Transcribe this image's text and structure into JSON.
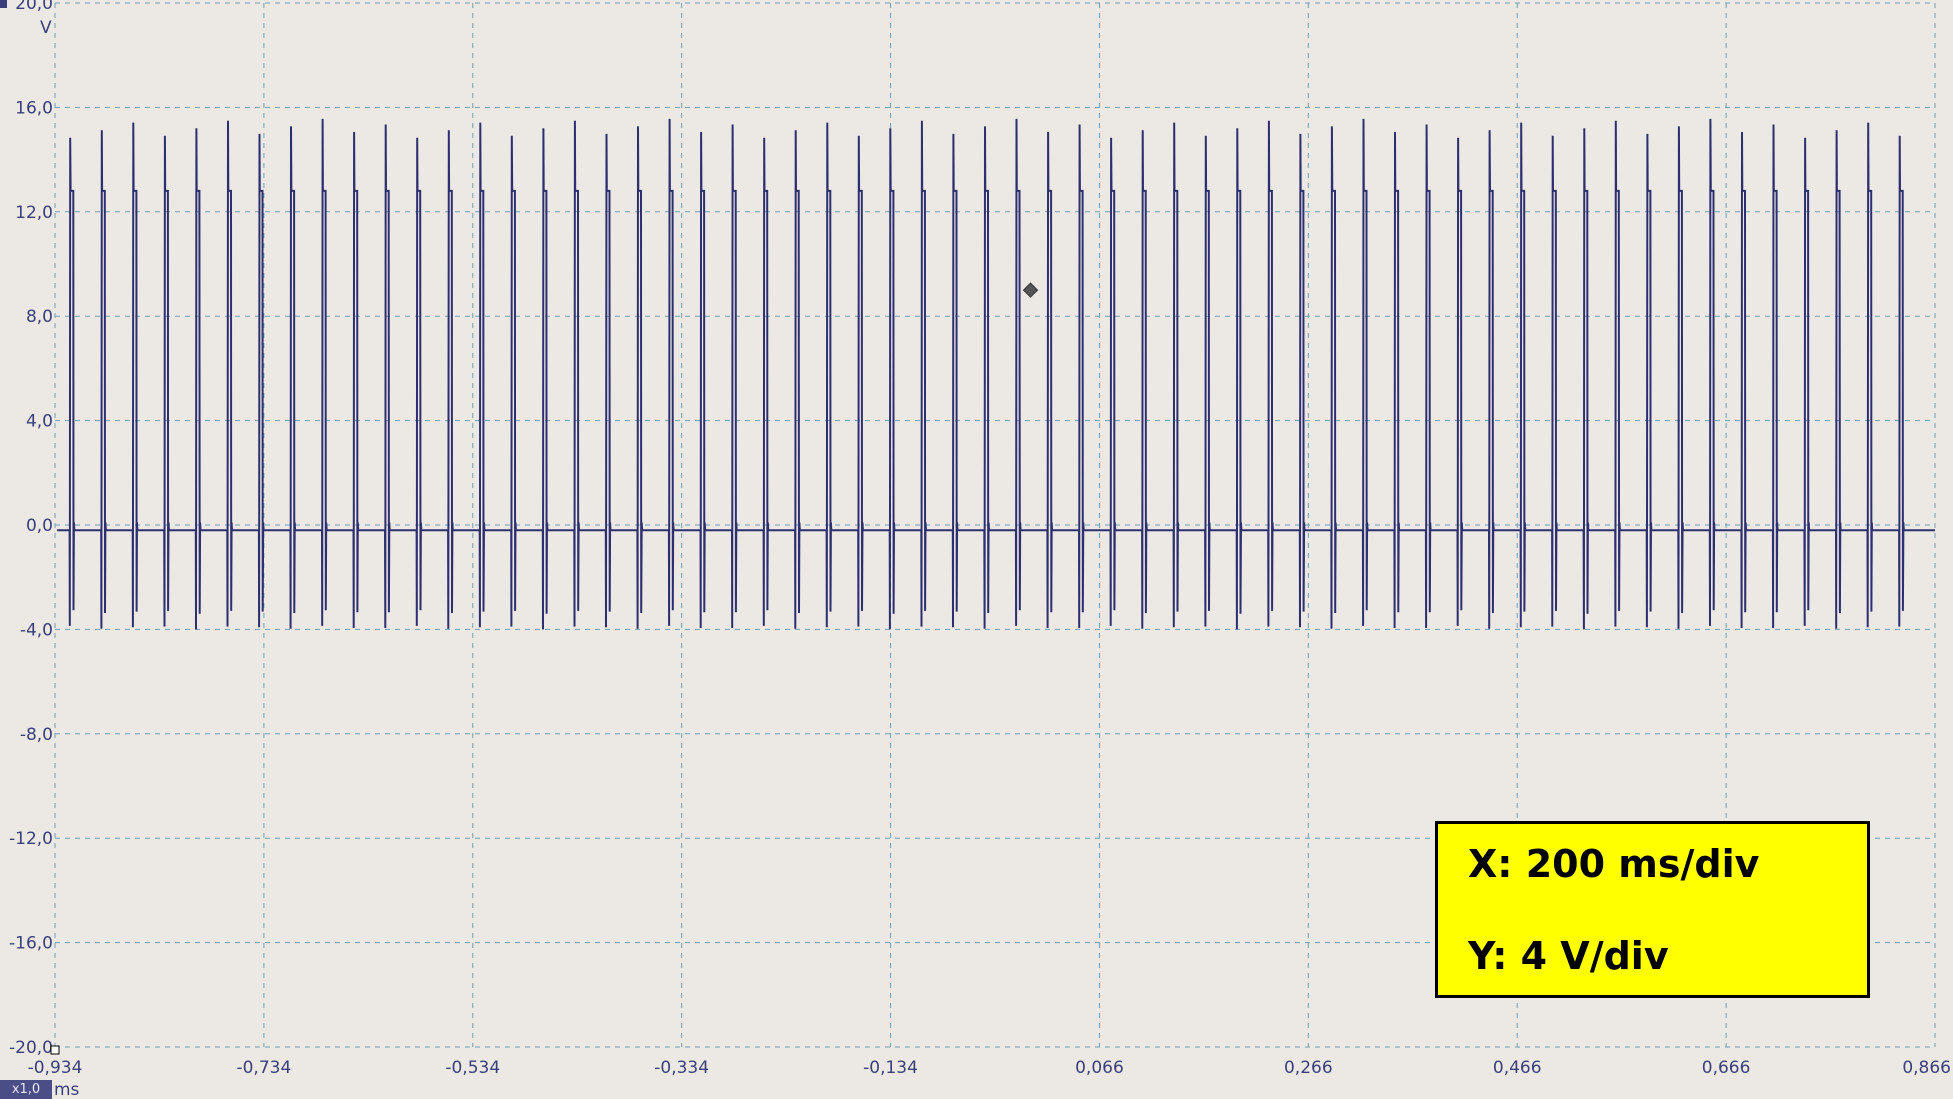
{
  "chart_data": {
    "type": "line",
    "title": "",
    "xlabel": "ms",
    "ylabel": "V",
    "xlim": [
      -0.934,
      0.866
    ],
    "ylim": [
      -20.0,
      20.0
    ],
    "x_ticks": [
      "-0,934",
      "-0,734",
      "-0,534",
      "-0,334",
      "-0,134",
      "0,066",
      "0,266",
      "0,466",
      "0,666",
      "0,866"
    ],
    "y_ticks": [
      "20,0",
      "16,0",
      "12,0",
      "8,0",
      "4,0",
      "0,0",
      "-4,0",
      "-8,0",
      "-12,0",
      "-16,0",
      "-20,0"
    ],
    "grid": true,
    "series": [
      {
        "color": "#2e2f6e",
        "pulse_period": 0.0302,
        "first_rise": -0.92,
        "pulse_width": 0.0035,
        "high": 12.8,
        "low": -0.2,
        "overshoot_peak": 15.2,
        "undershoot_peak": -4.0
      }
    ],
    "trigger_marker": {
      "x": 0.0,
      "y": 9.0
    }
  },
  "zoom": "x1,0",
  "info": {
    "x_scale": "X: 200 ms/div",
    "y_scale": "Y: 4 V/div"
  },
  "colors": {
    "background": "#ece9e5",
    "grid": "#6f9fb3",
    "trace": "#2e2f6e",
    "axis_text": "#3a3f7a",
    "info_box": "#ffff00"
  }
}
